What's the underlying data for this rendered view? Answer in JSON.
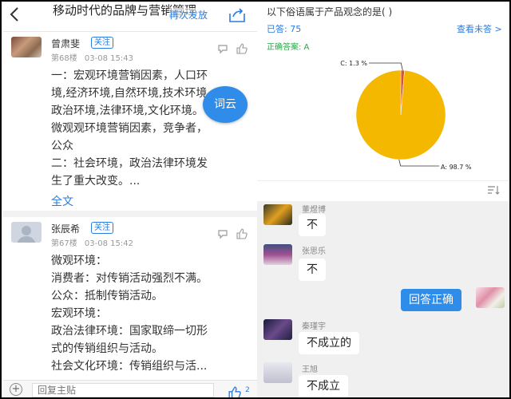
{
  "left": {
    "header": {
      "back_icon": "chevron-left-icon",
      "title": "移动时代的品牌与营销管理",
      "repost_label": "再次发放",
      "share_icon": "share-icon"
    },
    "posts": [
      {
        "author": "曾肃斐",
        "follow_label": "关注",
        "floor": "第68楼",
        "time": "03-08 15:43",
        "lines": [
          "一：宏观环境营销因素，人口环",
          "境,经济环境,自然环境,技术环境,",
          "政治环境,法律环境,文化环境。",
          "微观观环境营销因素，竞争者，",
          "公众",
          "二：社会环境，政治法律环境发",
          "生了重大改变。..."
        ],
        "more_label": "全文"
      },
      {
        "author": "张辰希",
        "follow_label": "关注",
        "floor": "第67楼",
        "time": "03-08 15:42",
        "lines": [
          "微观环境：",
          "消费者：对传销活动强烈不满。",
          "公众：抵制传销活动。",
          "宏观环境：",
          "政治法律环境：国家取缔一切形",
          "式的传销组织与活动。",
          "社会文化环境：传销组织与活..."
        ]
      }
    ],
    "ciyun_label": "词云",
    "reply_placeholder": "回复主贴",
    "like_count": "2"
  },
  "right": {
    "question": "以下俗语属于产品观念的是( )",
    "answered": "已答: 75",
    "view_unanswered": "查看未答 >",
    "correct_answer": "正确答案: A",
    "chat": [
      {
        "name": "董煜博",
        "text": "不"
      },
      {
        "name": "张思乐",
        "text": "不"
      },
      {
        "name": "",
        "text": "回答正确",
        "self": true
      },
      {
        "name": "秦瑾宇",
        "text": "不成立的"
      },
      {
        "name": "王旭",
        "text": "不成立"
      }
    ]
  },
  "chart_data": {
    "type": "pie",
    "categories": [
      "A",
      "C"
    ],
    "values": [
      98.7,
      1.3
    ],
    "labels": [
      "A: 98.7 %",
      "C: 1.3 %"
    ],
    "colors": [
      "#f5b800",
      "#e0532a"
    ]
  }
}
